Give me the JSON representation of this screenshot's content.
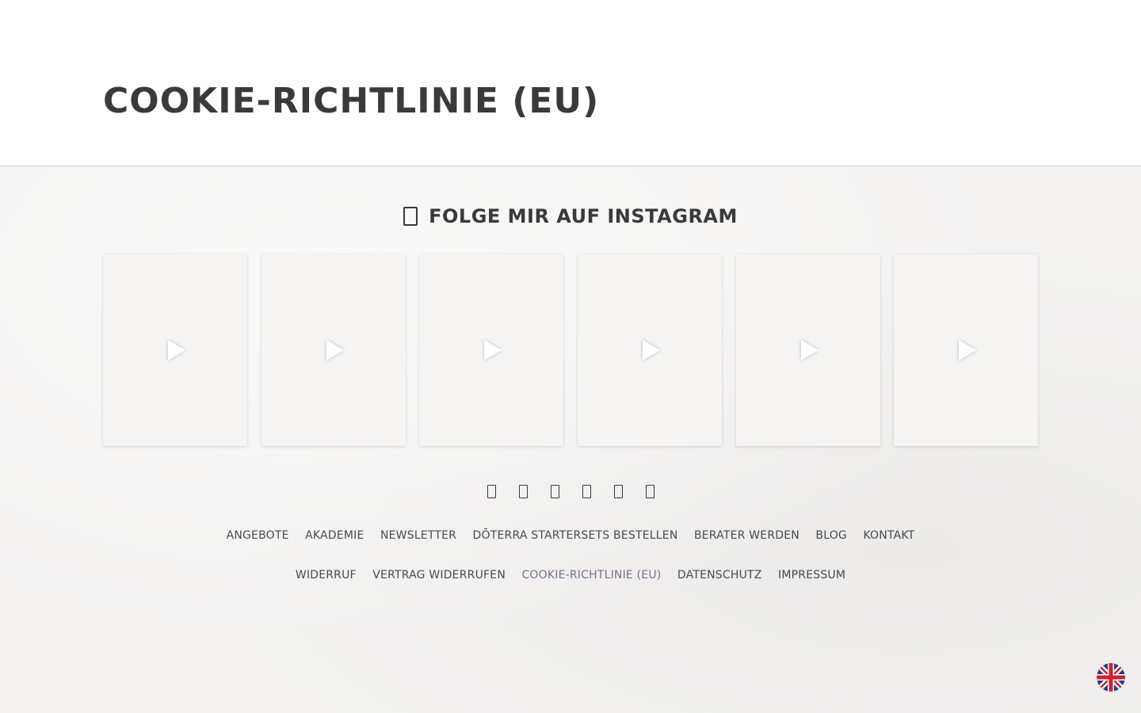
{
  "page": {
    "title": "COOKIE-RICHTLINIE (EU)"
  },
  "instagram": {
    "heading": "FOLGE MIR AUF INSTAGRAM",
    "icon": "instagram-icon",
    "posts": [
      {
        "type": "video"
      },
      {
        "type": "video"
      },
      {
        "type": "video"
      },
      {
        "type": "video"
      },
      {
        "type": "video"
      },
      {
        "type": "video"
      }
    ]
  },
  "social": {
    "icons": [
      "social-icon-1",
      "social-icon-2",
      "social-icon-3",
      "social-icon-4",
      "social-icon-5",
      "social-icon-6"
    ]
  },
  "nav_main": [
    "ANGEBOTE",
    "AKADEMIE",
    "NEWSLETTER",
    "DŌTERRA STARTERSETS BESTELLEN",
    "BERATER WERDEN",
    "BLOG",
    "KONTAKT"
  ],
  "nav_legal": [
    "WIDERRUF",
    "VERTRAG WIDERRUFEN",
    "COOKIE-RICHTLINIE (EU)",
    "DATENSCHUTZ",
    "IMPRESSUM"
  ],
  "nav_legal_active_index": 2,
  "language": {
    "icon": "uk-flag-icon"
  },
  "colors": {
    "text": "#3a3a3a",
    "active_link": "#7a6d92",
    "footer_bg": "#f3f2f1",
    "header_bg": "#ffffff"
  }
}
